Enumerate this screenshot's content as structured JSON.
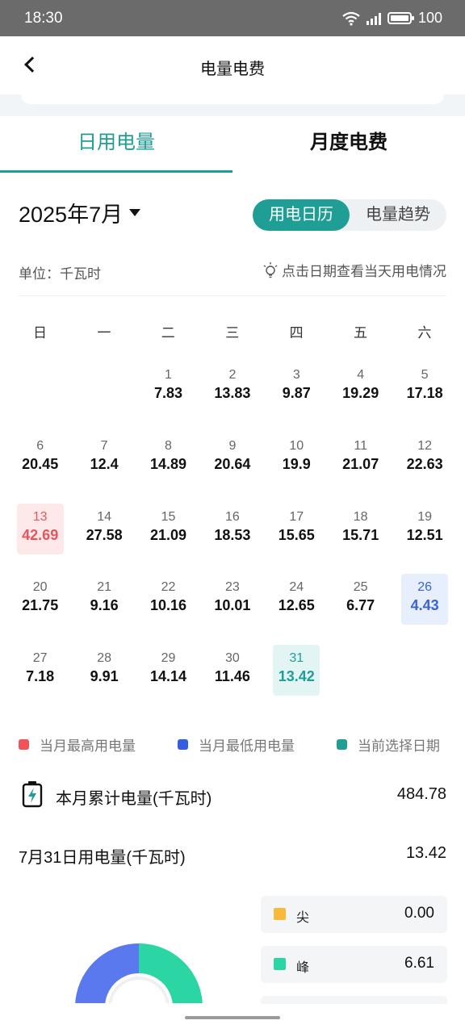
{
  "status_bar": {
    "time": "18:30",
    "battery": "100"
  },
  "nav": {
    "title": "电量电费"
  },
  "tabs": [
    {
      "label": "日用电量",
      "active": true
    },
    {
      "label": "月度电费",
      "active": false
    }
  ],
  "month_selector": {
    "value": "2025年7月"
  },
  "view_toggle": {
    "calendar": "用电日历",
    "trend": "电量趋势",
    "selected": "用电日历"
  },
  "unit": "单位：千瓦时",
  "hint": "点击日期查看当天用电情况",
  "weekdays": [
    "日",
    "一",
    "二",
    "三",
    "四",
    "五",
    "六"
  ],
  "calendar": {
    "first_weekday": 2,
    "days": [
      {
        "day": "1",
        "value": "7.83"
      },
      {
        "day": "2",
        "value": "13.83"
      },
      {
        "day": "3",
        "value": "9.87"
      },
      {
        "day": "4",
        "value": "19.29"
      },
      {
        "day": "5",
        "value": "17.18"
      },
      {
        "day": "6",
        "value": "20.45"
      },
      {
        "day": "7",
        "value": "12.4"
      },
      {
        "day": "8",
        "value": "14.89"
      },
      {
        "day": "9",
        "value": "20.64"
      },
      {
        "day": "10",
        "value": "19.9"
      },
      {
        "day": "11",
        "value": "21.07"
      },
      {
        "day": "12",
        "value": "22.63"
      },
      {
        "day": "13",
        "value": "42.69",
        "state": "max"
      },
      {
        "day": "14",
        "value": "27.58"
      },
      {
        "day": "15",
        "value": "21.09"
      },
      {
        "day": "16",
        "value": "18.53"
      },
      {
        "day": "17",
        "value": "15.65"
      },
      {
        "day": "18",
        "value": "15.71"
      },
      {
        "day": "19",
        "value": "12.51"
      },
      {
        "day": "20",
        "value": "21.75"
      },
      {
        "day": "21",
        "value": "9.16"
      },
      {
        "day": "22",
        "value": "10.16"
      },
      {
        "day": "23",
        "value": "10.01"
      },
      {
        "day": "24",
        "value": "12.65"
      },
      {
        "day": "25",
        "value": "6.77"
      },
      {
        "day": "26",
        "value": "4.43",
        "state": "min"
      },
      {
        "day": "27",
        "value": "7.18"
      },
      {
        "day": "28",
        "value": "9.91"
      },
      {
        "day": "29",
        "value": "14.14"
      },
      {
        "day": "30",
        "value": "11.46"
      },
      {
        "day": "31",
        "value": "13.42",
        "state": "selected"
      }
    ]
  },
  "legend": [
    {
      "label": "当月最高用电量",
      "color": "#f0545a"
    },
    {
      "label": "当月最低用电量",
      "color": "#3460e0"
    },
    {
      "label": "当前选择日期",
      "color": "#1f9e96"
    }
  ],
  "month_total": {
    "label": "本月累计电量(千瓦时)",
    "value": "484.78"
  },
  "selected_day": {
    "label": "7月31日用电量(千瓦时)",
    "value": "13.42"
  },
  "tou_breakdown": [
    {
      "label": "尖",
      "value": "0.00",
      "color": "#f9b93b"
    },
    {
      "label": "峰",
      "value": "6.61",
      "color": "#2cd6a4"
    }
  ],
  "donut_colors": {
    "left": "#5b79ee",
    "right": "#2cd6a4"
  }
}
